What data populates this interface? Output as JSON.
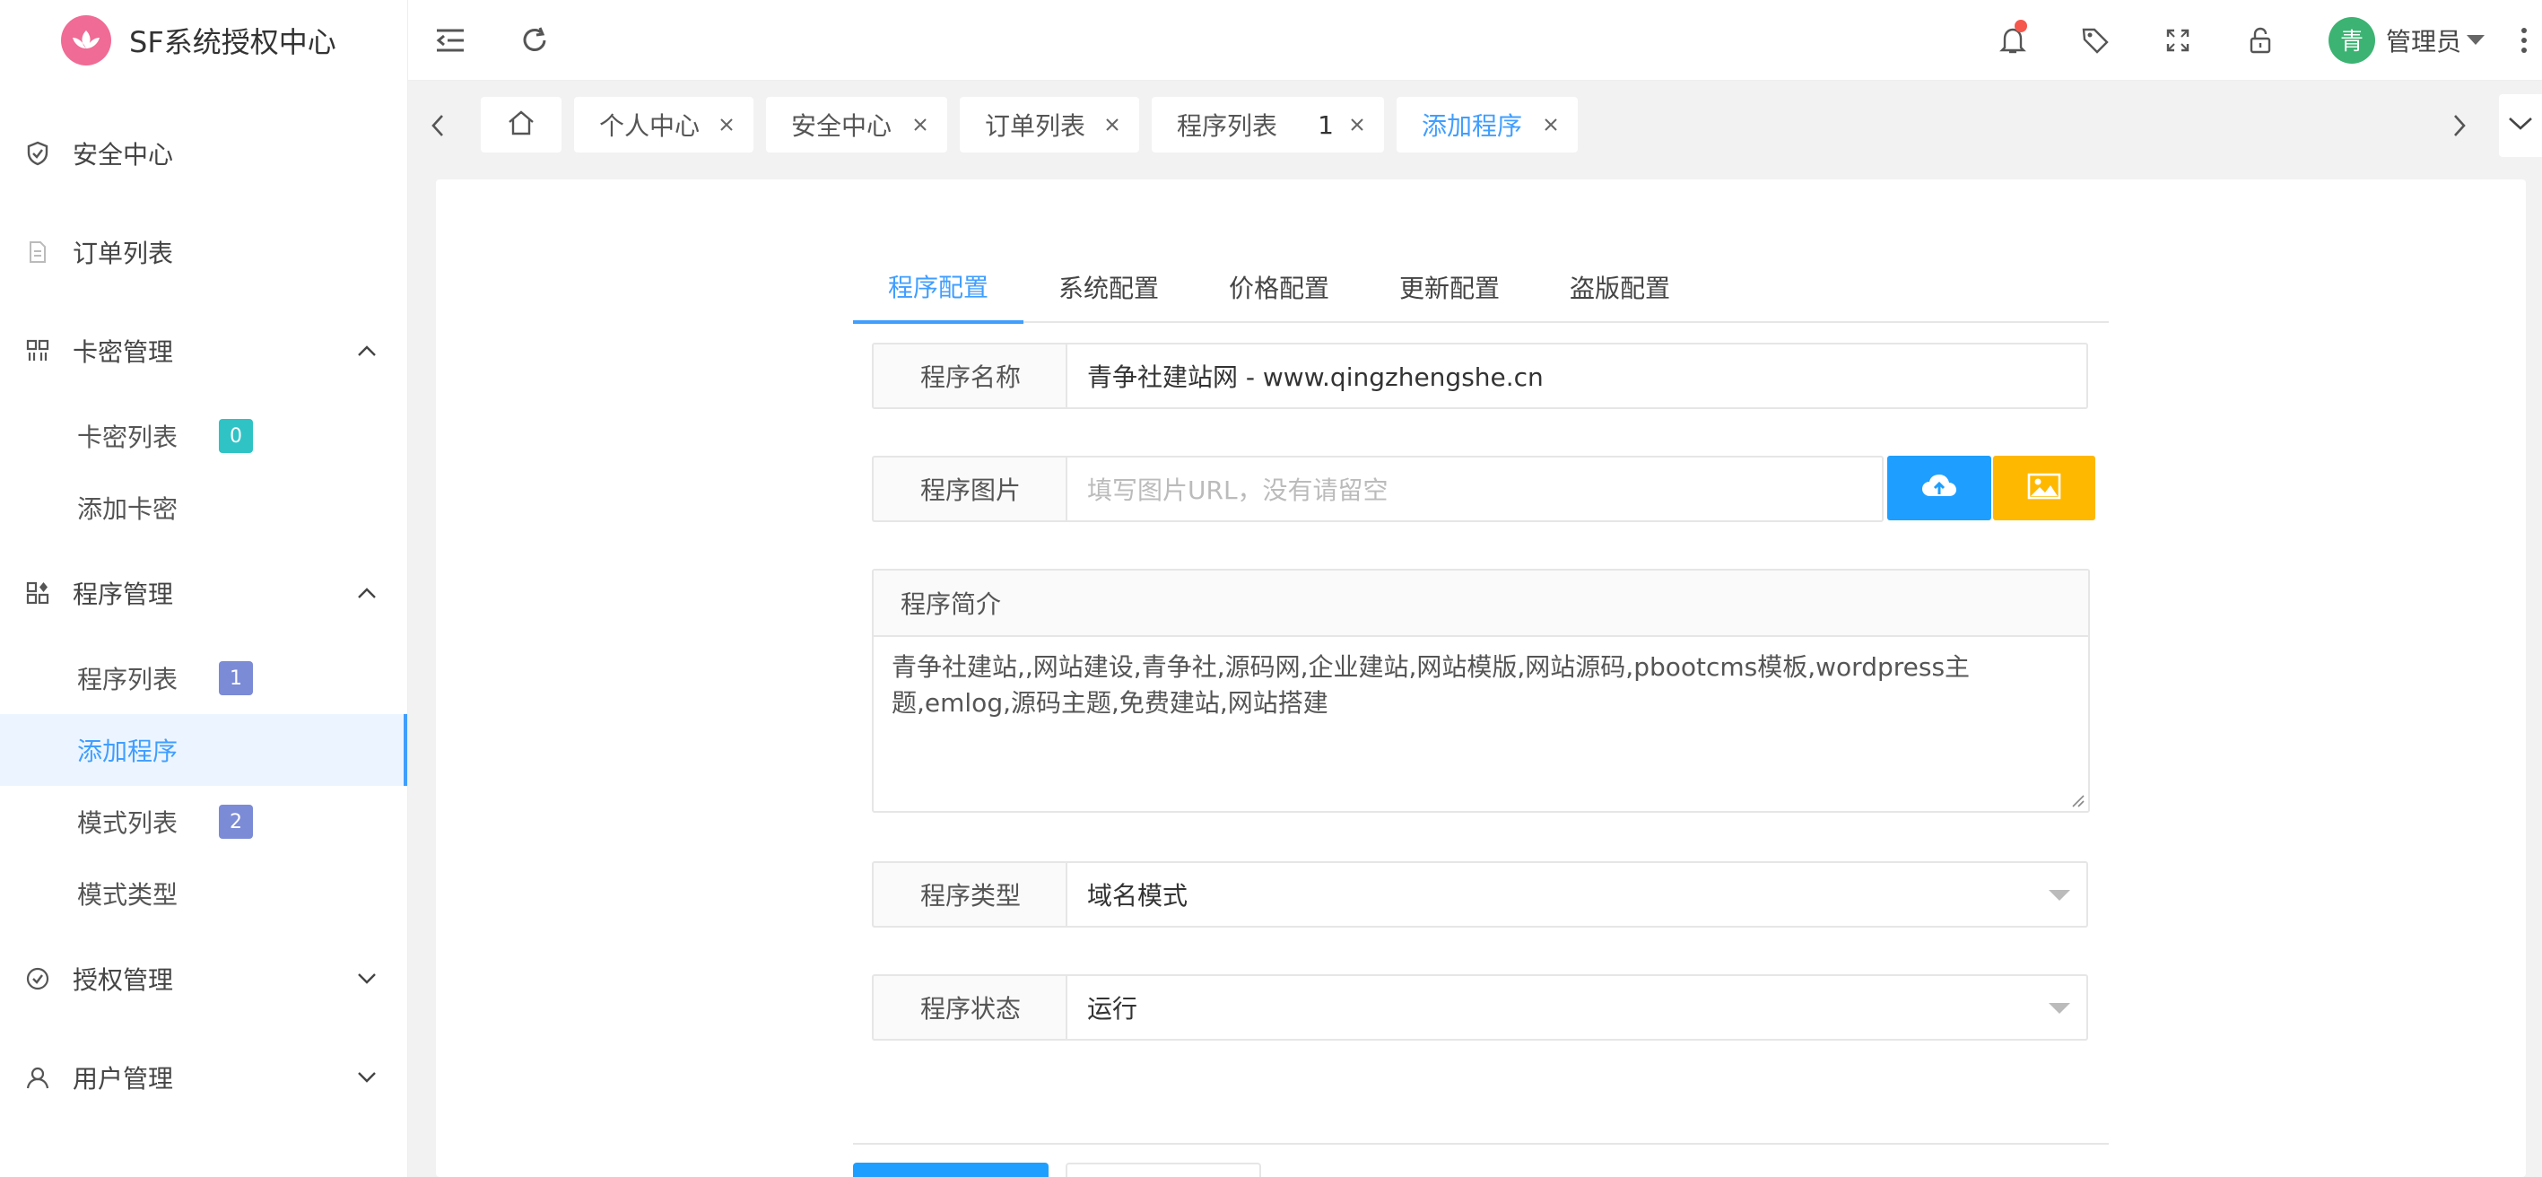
{
  "app": {
    "title": "SF系统授权中心",
    "logo_icon": "lotus-icon",
    "logo_color": "#f06b95"
  },
  "sidebar": {
    "items": [
      {
        "label": "安全中心",
        "icon": "shield-check-icon"
      },
      {
        "label": "订单列表",
        "icon": "document-icon"
      },
      {
        "label": "卡密管理",
        "icon": "grid-icon",
        "expanded": true,
        "children": [
          {
            "label": "卡密列表",
            "badge": "0",
            "badge_color": "#2fc3c6"
          },
          {
            "label": "添加卡密"
          }
        ]
      },
      {
        "label": "程序管理",
        "icon": "apps-icon",
        "expanded": true,
        "children": [
          {
            "label": "程序列表",
            "badge": "1",
            "badge_color": "#7c8bd6"
          },
          {
            "label": "添加程序",
            "active": true
          },
          {
            "label": "模式列表",
            "badge": "2",
            "badge_color": "#7c8bd6"
          },
          {
            "label": "模式类型"
          }
        ]
      },
      {
        "label": "授权管理",
        "icon": "check-circle-icon",
        "expanded": false
      },
      {
        "label": "用户管理",
        "icon": "user-icon",
        "expanded": false
      }
    ]
  },
  "header": {
    "user_name": "管理员",
    "avatar_text": "青",
    "accent": "#409eff"
  },
  "tabs": [
    {
      "label": "个人中心"
    },
    {
      "label": "安全中心"
    },
    {
      "label": "订单列表"
    },
    {
      "label": "程序列表",
      "count": "1"
    },
    {
      "label": "添加程序",
      "active": true
    }
  ],
  "form": {
    "tabs": [
      "程序配置",
      "系统配置",
      "价格配置",
      "更新配置",
      "盗版配置"
    ],
    "name": {
      "label": "程序名称",
      "value": "青争社建站网 - www.qingzhengshe.cn"
    },
    "image": {
      "label": "程序图片",
      "placeholder": "填写图片URL，没有请留空"
    },
    "intro": {
      "label": "程序简介",
      "value": "青争社建站,,网站建设,青争社,源码网,企业建站,网站模版,网站源码,pbootcms模板,wordpress主题,emlog,源码主题,免费建站,网站搭建"
    },
    "type": {
      "label": "程序类型",
      "value": "域名模式"
    },
    "status": {
      "label": "程序状态",
      "value": "运行"
    },
    "upload_color": "#1e9fff",
    "image_btn_color": "#ffb800"
  }
}
